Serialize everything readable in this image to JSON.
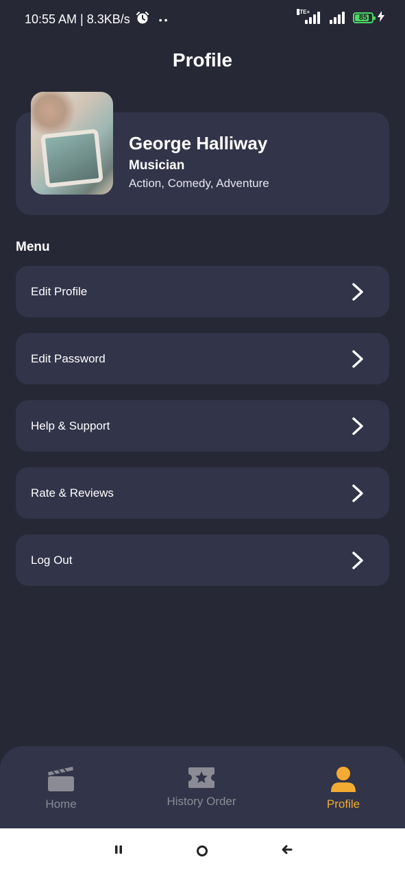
{
  "status_bar": {
    "time_speed": "10:55 AM | 8.3KB/s",
    "alarm_icon": "alarm-clock-icon",
    "dots": "••",
    "network": "LTE+",
    "battery": "85",
    "battery_level_percent": 85
  },
  "header": {
    "title": "Profile"
  },
  "profile": {
    "name": "George Halliway",
    "role": "Musician",
    "genres": "Action, Comedy, Adventure"
  },
  "menu": {
    "heading": "Menu",
    "items": [
      {
        "label": "Edit Profile",
        "icon": "chevron-right-icon"
      },
      {
        "label": "Edit Password",
        "icon": "chevron-right-icon"
      },
      {
        "label": "Help & Support",
        "icon": "chevron-right-icon"
      },
      {
        "label": "Rate & Reviews",
        "icon": "chevron-right-icon"
      },
      {
        "label": "Log Out",
        "icon": "chevron-right-icon"
      }
    ]
  },
  "bottom_nav": {
    "items": [
      {
        "label": "Home",
        "icon": "clapperboard-icon",
        "active": false
      },
      {
        "label": "History Order",
        "icon": "ticket-star-icon",
        "active": false
      },
      {
        "label": "Profile",
        "icon": "person-icon",
        "active": true
      }
    ]
  },
  "colors": {
    "background": "#272836",
    "card": "#323449",
    "accent": "#f4ab31",
    "inactive": "#8a8b94",
    "battery": "#4cd964"
  },
  "system_nav": {
    "buttons": [
      "recents-icon",
      "home-circle-icon",
      "back-icon"
    ]
  }
}
